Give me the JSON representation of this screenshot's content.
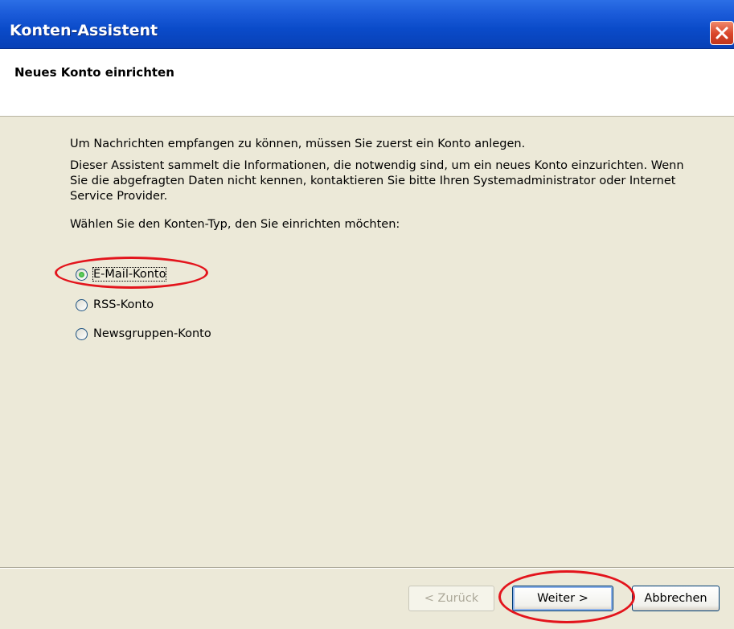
{
  "window": {
    "title": "Konten-Assistent",
    "close_icon": "close-icon"
  },
  "header": {
    "title": "Neues Konto einrichten"
  },
  "content": {
    "intro": "Um Nachrichten empfangen zu können, müssen Sie zuerst ein Konto anlegen.",
    "description": "Dieser Assistent sammelt die Informationen, die notwendig sind, um ein neues Konto einzurichten. Wenn Sie die abgefragten Daten nicht kennen, kontaktieren Sie bitte Ihren Systemadministrator oder Internet Service Provider.",
    "prompt": "Wählen Sie den Konten-Typ, den Sie einrichten möchten:",
    "options": [
      {
        "label": "E-Mail-Konto",
        "checked": true
      },
      {
        "label": "RSS-Konto",
        "checked": false
      },
      {
        "label": "Newsgruppen-Konto",
        "checked": false
      }
    ]
  },
  "buttons": {
    "back": "< Zurück",
    "next": "Weiter >",
    "cancel": "Abbrechen"
  },
  "colors": {
    "title_bar": "#0a4bc9",
    "dialog_bg": "#ece9d8",
    "annotation": "#e3141c"
  }
}
